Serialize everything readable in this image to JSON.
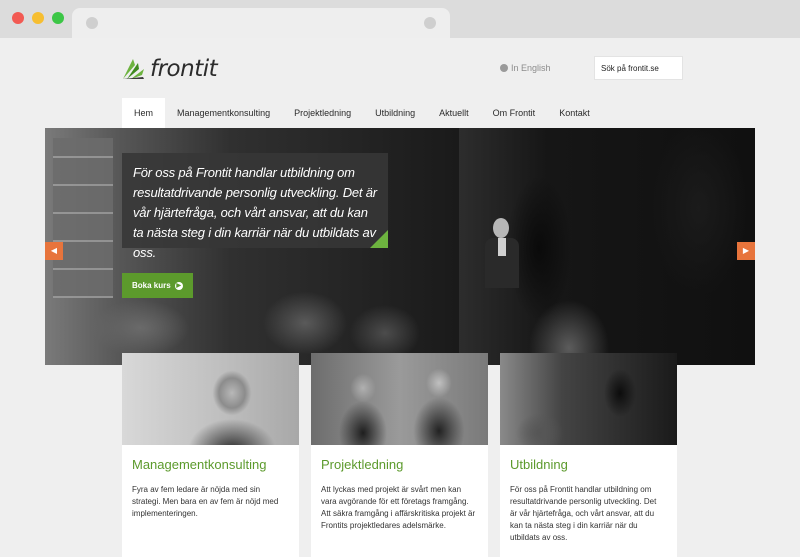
{
  "header": {
    "logo_text": "frontit",
    "language_link": "In English",
    "search_placeholder": "Sök på frontit.se"
  },
  "nav": {
    "items": [
      "Hem",
      "Managementkonsulting",
      "Projektledning",
      "Utbildning",
      "Aktuellt",
      "Om Frontit",
      "Kontakt"
    ],
    "active": "Hem"
  },
  "hero": {
    "quote": "För oss på Frontit handlar utbildning om resultatdrivande personlig utveckling. Det är vår hjärtefråga, och vårt ansvar, att du kan ta nästa steg i din karriär när du utbildats av oss.",
    "cta_label": "Boka kurs"
  },
  "cards": [
    {
      "title": "Managementkonsulting",
      "text": "Fyra av fem ledare är nöjda med sin strategi. Men bara en av fem är nöjd med implementeringen."
    },
    {
      "title": "Projektledning",
      "text": "Att lyckas med projekt är svårt men kan vara avgörande för ett företags framgång. Att säkra framgång i affärskritiska projekt är Frontits projektledares adelsmärke."
    },
    {
      "title": "Utbildning",
      "text": "För oss på Frontit handlar utbildning om resultatdrivande personlig utveckling. Det är vår hjärtefråga, och vårt ansvar, att du kan ta nästa steg i din karriär när du utbildats av oss."
    }
  ],
  "colors": {
    "brand_green": "#5c9a2c",
    "accent_orange": "#e7743c"
  },
  "icons": {
    "slider_prev": "chevron-left-icon",
    "slider_next": "chevron-right-icon",
    "cta": "arrow-right-circle-icon",
    "language": "globe-icon"
  }
}
